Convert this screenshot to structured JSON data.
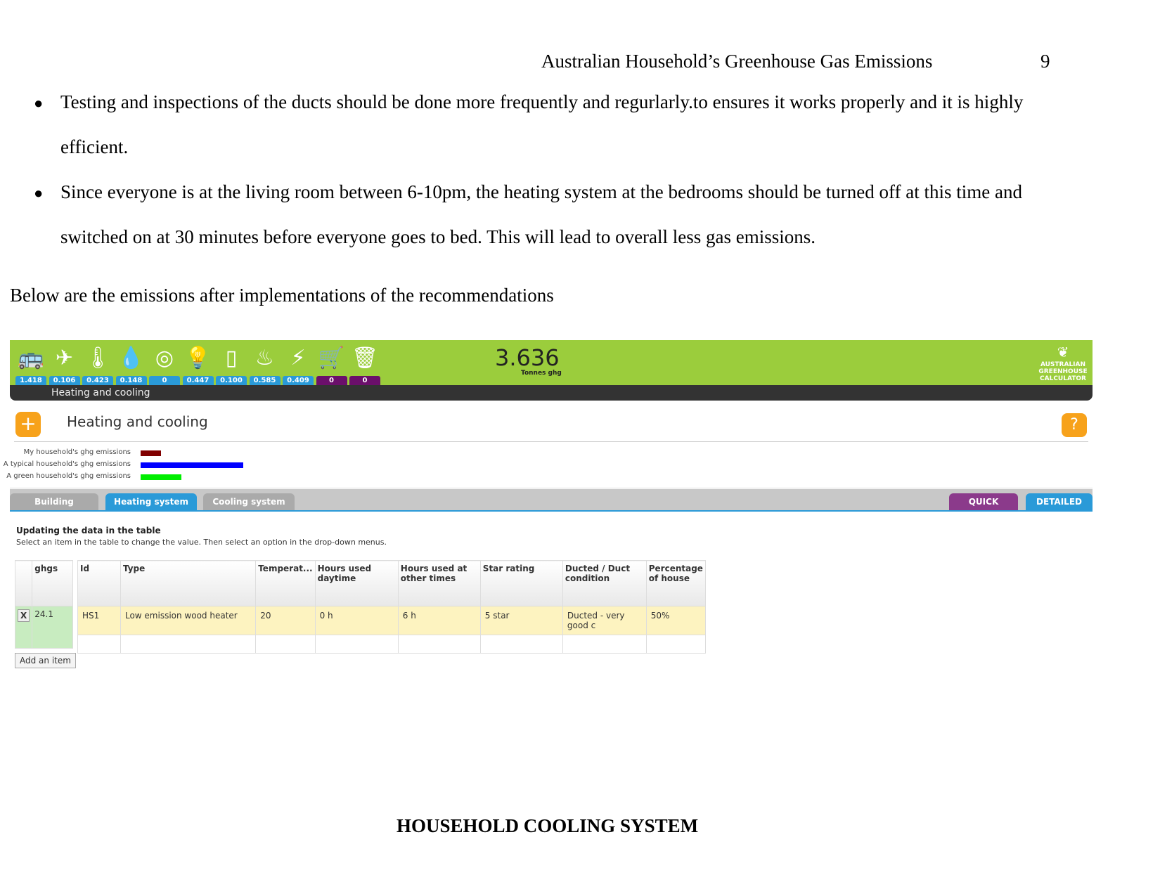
{
  "header": {
    "running_title": "Australian Household’s Greenhouse Gas Emissions",
    "page_number": "9"
  },
  "bullets": [
    {
      "line1": "Testing and inspections of the ducts should be done more frequently and regurlarly.to ensures it works properly and it is highly",
      "line2": "efficient."
    },
    {
      "line1": "Since everyone is at the living room between 6-10pm, the heating system at the bedrooms should be turned off at this time and",
      "line2": "switched on at 30 minutes before everyone goes to bed. This will lead to overall less gas emissions."
    }
  ],
  "intro": "Below are the emissions after implementations of the recommendations",
  "calculator": {
    "categories": [
      {
        "icon": "car-bus-icon",
        "value": "1.418"
      },
      {
        "icon": "airplane-icon",
        "value": "0.106"
      },
      {
        "icon": "thermometer-icon",
        "value": "0.423"
      },
      {
        "icon": "hot-water-icon",
        "value": "0.148"
      },
      {
        "icon": "washing-machine-icon",
        "value": "0"
      },
      {
        "icon": "light-bulb-icon",
        "value": "0.447"
      },
      {
        "icon": "fridge-icon",
        "value": "0.100"
      },
      {
        "icon": "cooking-pot-icon",
        "value": "0.585"
      },
      {
        "icon": "appliances-plug-icon",
        "value": "0.409"
      },
      {
        "icon": "shopping-cart-icon",
        "value": "0"
      },
      {
        "icon": "waste-bin-icon",
        "value": "0"
      }
    ],
    "total": "3.636",
    "total_unit": "Tonnes ghg",
    "logo": "AUSTRALIAN GREENHOUSE CALCULATOR",
    "breadcrumb": "Heating and cooling",
    "section_title": "Heating and cooling",
    "help": "?",
    "comparison": [
      {
        "label": "My household's ghg emissions",
        "value": 0.2,
        "color": "#800000"
      },
      {
        "label": "A typical household's ghg emissions",
        "value": 1.0,
        "color": "#0000ff"
      },
      {
        "label": "A green household's ghg emissions",
        "value": 0.4,
        "color": "#00ee00"
      }
    ],
    "tabs": [
      "Building",
      "Heating system",
      "Cooling system"
    ],
    "mode_tabs": [
      "QUICK",
      "DETAILED"
    ],
    "instructions_title": "Updating the data in the table",
    "instructions": "Select an item in the table to change the value. Then select an option in the drop-down menus.",
    "ghgs_header": "ghgs",
    "columns": [
      "Id",
      "Type",
      "Temperat...",
      "Hours used daytime",
      "Hours used at other times",
      "Star rating",
      "Ducted / Duct condition",
      "Percentage of house"
    ],
    "rows": [
      {
        "remove": "X",
        "ghgs": "24.1",
        "cells": [
          "HS1",
          "Low emission wood heater",
          "20",
          "0 h",
          "6 h",
          "5 star",
          "Ducted - very good c",
          "50%"
        ]
      }
    ],
    "add_item": "Add an item"
  },
  "caption": "HOUSEHOLD COOLING SYSTEM"
}
